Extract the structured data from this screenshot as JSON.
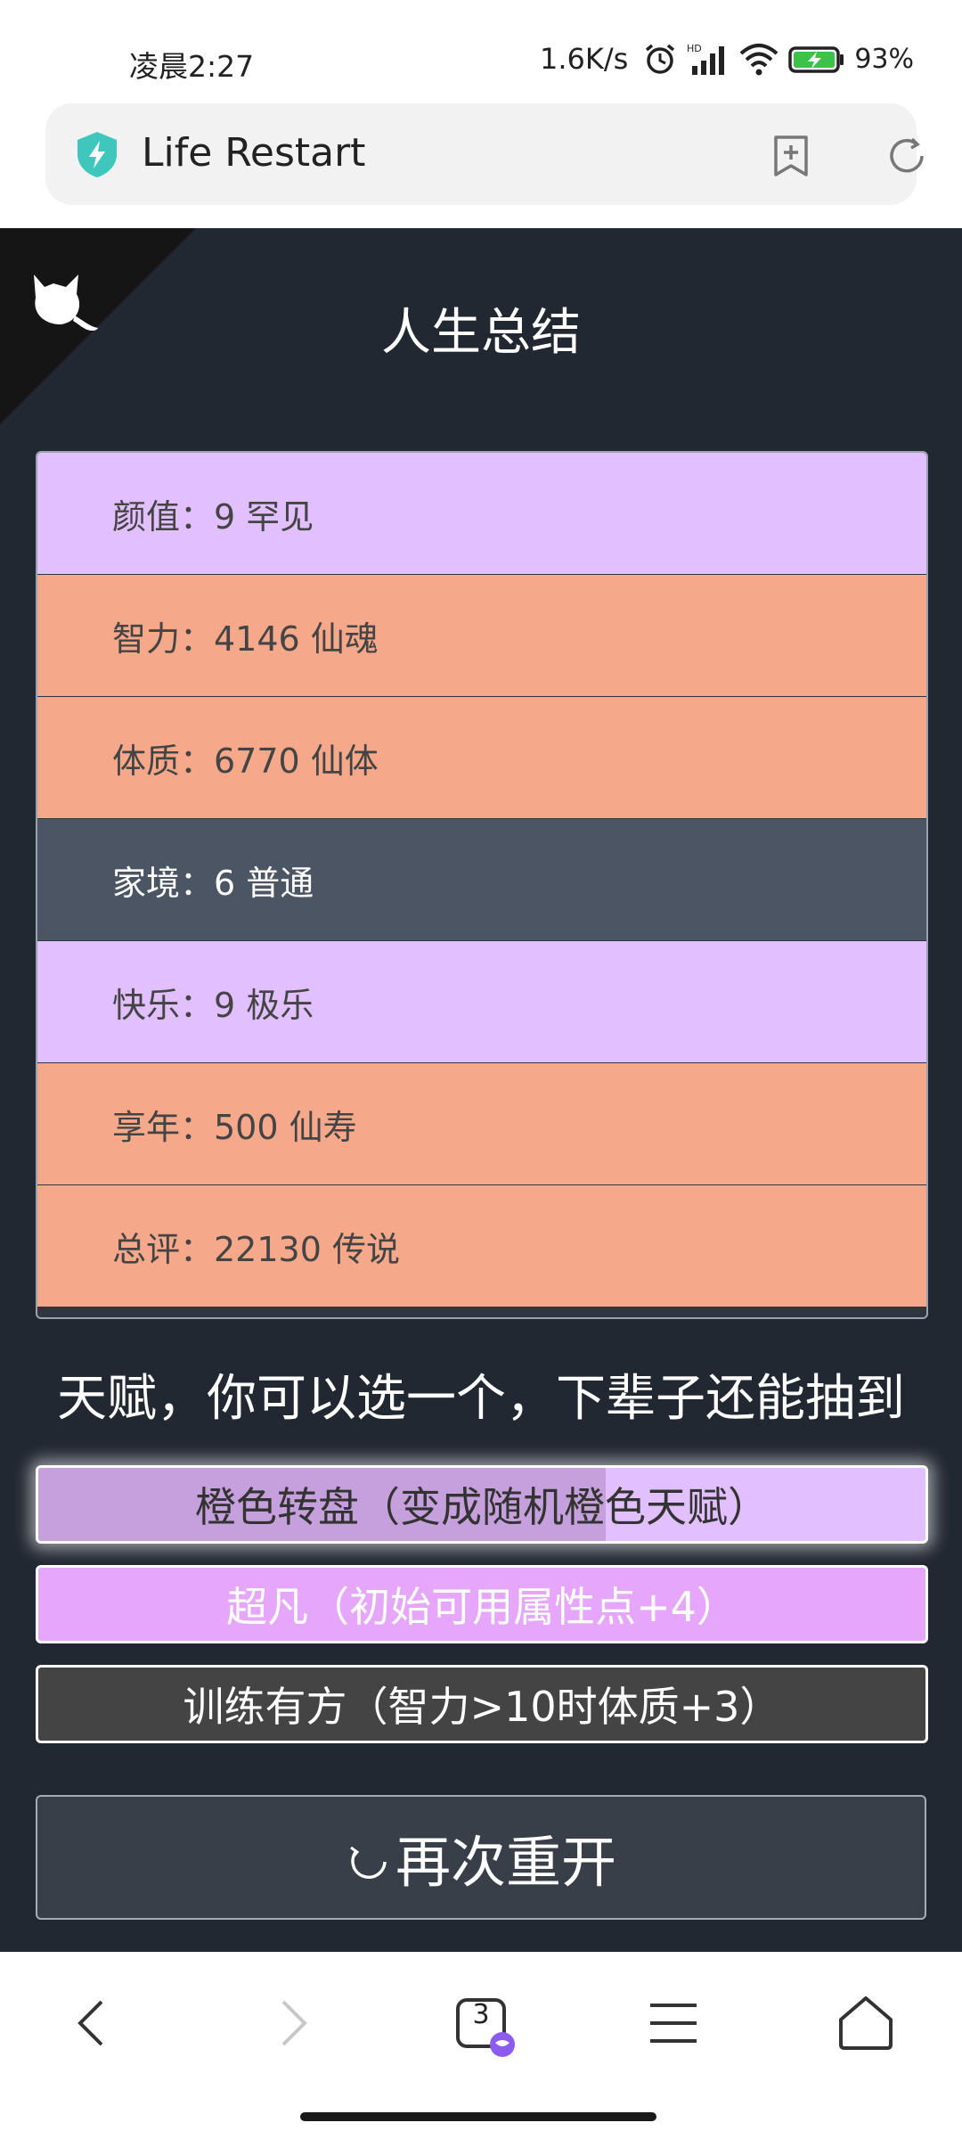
{
  "status_bar": {
    "time": "凌晨2:27",
    "net_speed": "1.6K/s",
    "battery": "93%"
  },
  "browser": {
    "title": "Life Restart",
    "tab_count": "3"
  },
  "page": {
    "title": "人生总结",
    "summary": [
      {
        "label": "颜值：9 罕见",
        "color": "purple"
      },
      {
        "label": "智力：4146 仙魂",
        "color": "orange"
      },
      {
        "label": "体质：6770 仙体",
        "color": "orange"
      },
      {
        "label": "家境：6 普通",
        "color": "gray"
      },
      {
        "label": "快乐：9 极乐",
        "color": "purple"
      },
      {
        "label": "享年：500 仙寿",
        "color": "orange"
      },
      {
        "label": "总评：22130 传说",
        "color": "orange"
      }
    ],
    "talent_heading": "天赋，你可以选一个，下辈子还能抽到",
    "talents": [
      {
        "label": "橙色转盘（变成随机橙色天赋）",
        "progress": 0.64
      },
      {
        "label": "超凡（初始可用属性点+4）"
      },
      {
        "label": "训练有方（智力>10时体质+3）"
      }
    ],
    "restart_button": "再次重开"
  },
  "colors": {
    "background": "#222831",
    "purple": "#e2bfff",
    "orange": "#f6a98a",
    "gray": "#4b5563"
  }
}
